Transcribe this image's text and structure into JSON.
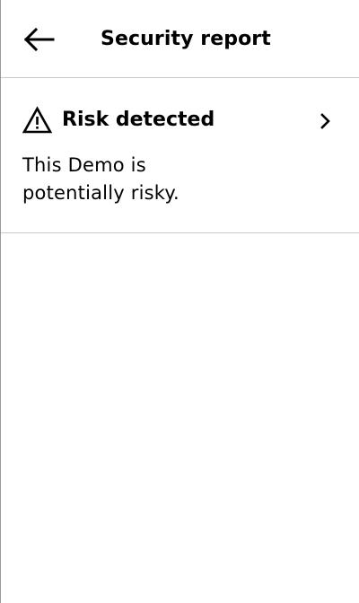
{
  "header": {
    "title": "Security report",
    "back_icon": "arrow-left-icon"
  },
  "risk_card": {
    "title": "Risk detected",
    "description": "This Demo is potentially risky.",
    "warning_icon": "warning-triangle-icon",
    "chevron_icon": "chevron-right-icon"
  }
}
